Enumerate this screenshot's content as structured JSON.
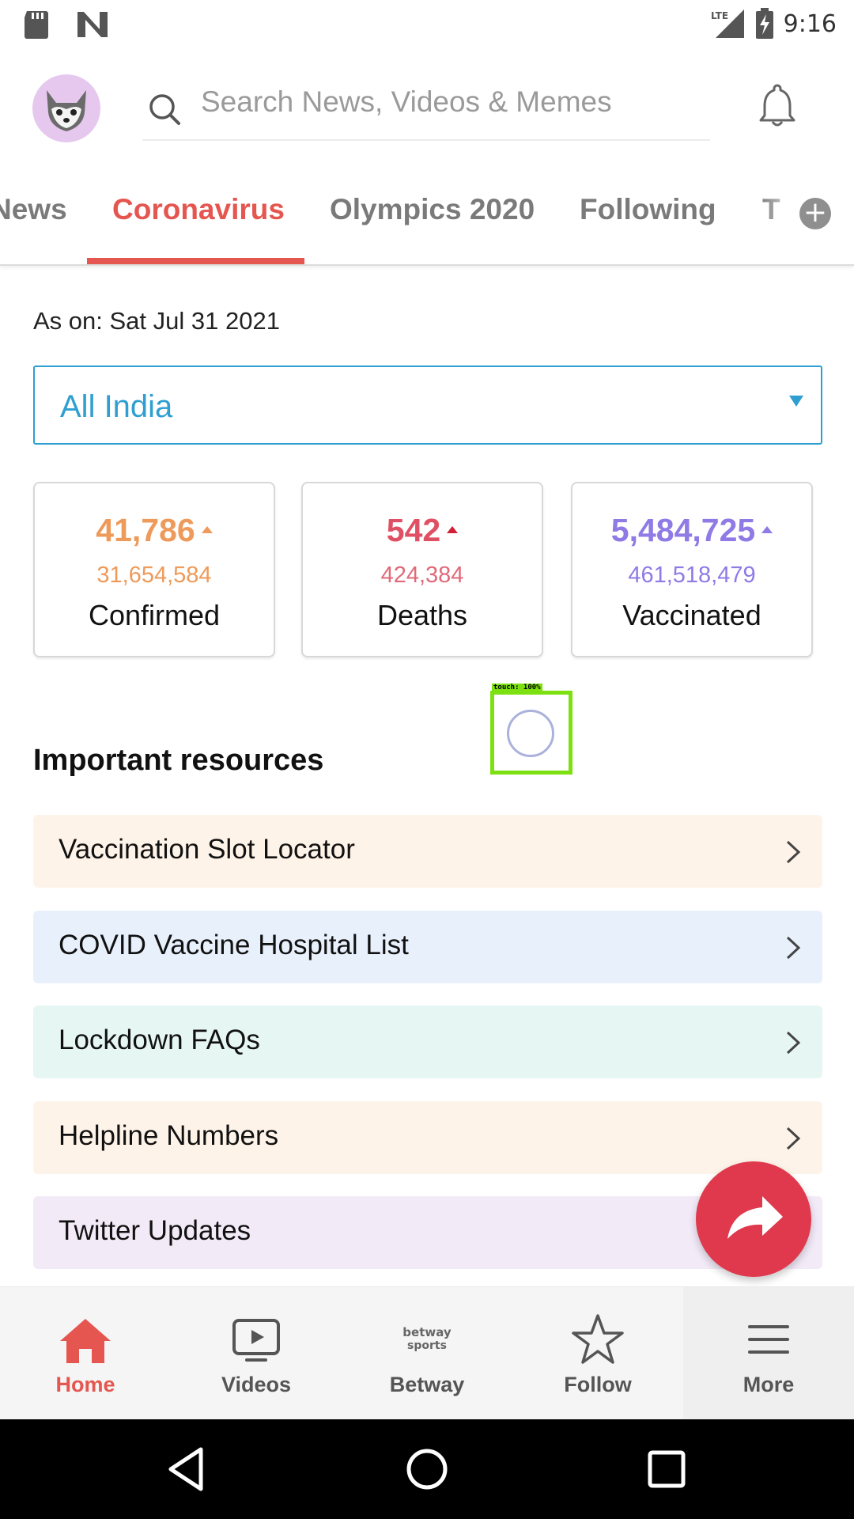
{
  "status_bar": {
    "time": "9:16",
    "network": "LTE"
  },
  "header": {
    "search_placeholder": "Search News, Videos & Memes"
  },
  "tabs": [
    {
      "label": "News",
      "active": false
    },
    {
      "label": "Coronavirus",
      "active": true
    },
    {
      "label": "Olympics 2020",
      "active": false
    },
    {
      "label": "Following",
      "active": false
    },
    {
      "label": "T",
      "active": false
    }
  ],
  "tab_add_label": "+",
  "as_on": "As on: Sat Jul 31 2021",
  "region": {
    "selected": "All India"
  },
  "stats": [
    {
      "value": "41,786",
      "total": "31,654,584",
      "label": "Confirmed",
      "color": "#ee9a5a",
      "total_color": "#ee9a5a"
    },
    {
      "value": "542",
      "total": "424,384",
      "label": "Deaths",
      "color": "#e05064",
      "total_color": "#e06a7a"
    },
    {
      "value": "5,484,725",
      "total": "461,518,479",
      "label": "Vaccinated",
      "color": "#8f7ae6",
      "total_color": "#8f7ae6"
    }
  ],
  "touch_indicator": "touch: 100%",
  "resources": {
    "title": "Important resources",
    "items": [
      {
        "label": "Vaccination Slot Locator",
        "bg": "#fef3e8"
      },
      {
        "label": "COVID Vaccine Hospital List",
        "bg": "#e8f0fb"
      },
      {
        "label": "Lockdown FAQs",
        "bg": "#e6f7f3"
      },
      {
        "label": "Helpline Numbers",
        "bg": "#fef3e8"
      },
      {
        "label": "Twitter Updates",
        "bg": "#f3eaf8"
      }
    ]
  },
  "bottom_nav": [
    {
      "label": "Home",
      "icon": "home-icon",
      "active": true
    },
    {
      "label": "Videos",
      "icon": "video-icon",
      "active": false
    },
    {
      "label": "Betway",
      "icon": "betway-logo",
      "active": false
    },
    {
      "label": "Follow",
      "icon": "star-icon",
      "active": false
    },
    {
      "label": "More",
      "icon": "menu-icon",
      "active": false
    }
  ],
  "betway_logo_text": [
    "betway",
    "sports"
  ],
  "colors": {
    "accent": "#e4564f",
    "link": "#2f9fd1",
    "fab": "#e0394d"
  }
}
